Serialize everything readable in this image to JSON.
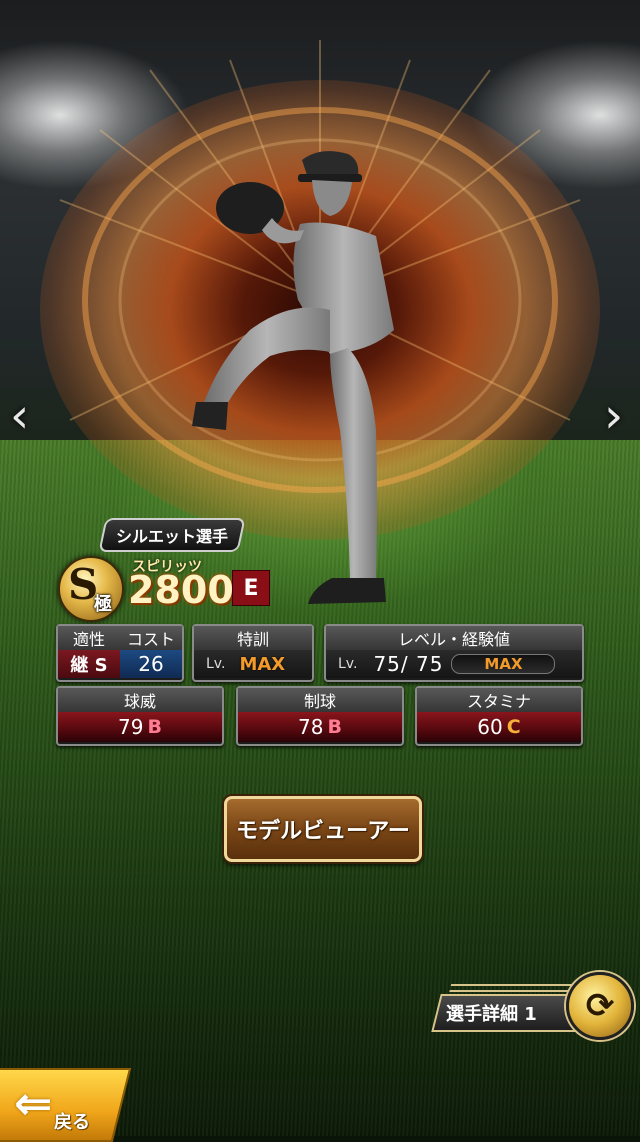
{
  "player": {
    "tag": "シルエット選手",
    "rank_letter": "S",
    "rank_kanji": "極",
    "spirits_label": "スピリッツ",
    "spirits_value": "2800",
    "team_logo_text": "E"
  },
  "aptitude": {
    "header_left": "適性",
    "header_right": "コスト",
    "value_left": "継 S",
    "value_right": "26"
  },
  "tokkun": {
    "header": "特訓",
    "lv_label": "Lv.",
    "value": "MAX"
  },
  "level": {
    "header": "レベル・経験値",
    "lv_label": "Lv.",
    "current": "75",
    "separator": "/",
    "max": "75",
    "bar_text": "MAX"
  },
  "stats": [
    {
      "label": "球威",
      "value": "79",
      "grade": "B"
    },
    {
      "label": "制球",
      "value": "78",
      "grade": "B"
    },
    {
      "label": "スタミナ",
      "value": "60",
      "grade": "C"
    }
  ],
  "buttons": {
    "model_viewer": "モデルビューアー",
    "detail": "選手詳細 1",
    "back": "戻る"
  },
  "nav": {
    "prev": "‹",
    "next": "›"
  },
  "colors": {
    "accent_orange": "#f29a2a",
    "grade_b": "#ff7d92",
    "grade_c": "#f5b13a",
    "button_gold": "#f0d79a"
  }
}
